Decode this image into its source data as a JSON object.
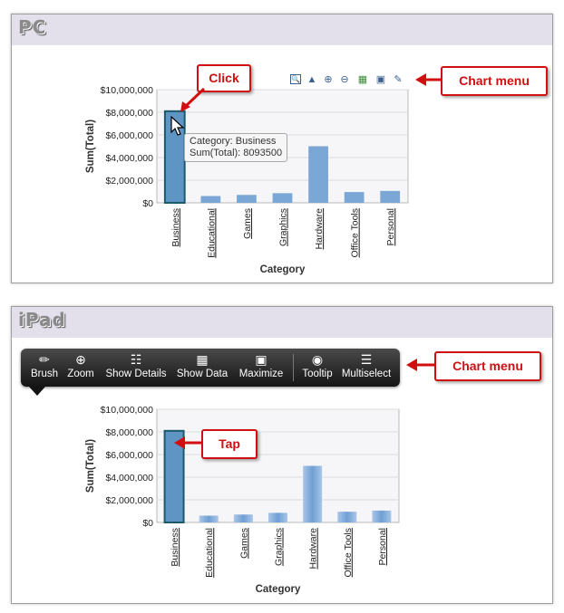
{
  "pc": {
    "title": "PC",
    "callout_click": "Click",
    "callout_menu": "Chart menu",
    "tooltip_line1": "Category: Business",
    "tooltip_line2": "Sum(Total): 8093500",
    "menu_icons": [
      "details-icon",
      "tooltip-icon",
      "zoom-in-icon",
      "zoom-out-icon",
      "show-data-icon",
      "maximize-icon",
      "edit-icon"
    ]
  },
  "ipad": {
    "title": "iPad",
    "callout_tap": "Tap",
    "callout_menu": "Chart menu",
    "toolbar": [
      {
        "label": "Brush",
        "icon": "brush-icon"
      },
      {
        "label": "Zoom",
        "icon": "zoom-icon"
      },
      {
        "label": "Show Details",
        "icon": "details-icon"
      },
      {
        "label": "Show Data",
        "icon": "grid-icon"
      },
      {
        "label": "Maximize",
        "icon": "maximize-icon"
      },
      {
        "label": "Tooltip",
        "icon": "speech-bubble-icon"
      },
      {
        "label": "Multiselect",
        "icon": "checklist-icon"
      }
    ]
  },
  "colors": {
    "bar": "#7ba7d6",
    "selected_bar": "#5f95c4",
    "selected_border": "#1c5a6b",
    "callout": "#d01010"
  },
  "chart_data": [
    {
      "type": "bar",
      "categories": [
        "Business",
        "Educational",
        "Games",
        "Graphics",
        "Hardware",
        "Office Tools",
        "Personal"
      ],
      "values": [
        8093500,
        600000,
        700000,
        850000,
        5000000,
        950000,
        1050000
      ],
      "xlabel": "Category",
      "ylabel": "Sum(Total)",
      "ylim": [
        0,
        10000000
      ],
      "yticks": [
        "$0",
        "$2,000,000",
        "$4,000,000",
        "$6,000,000",
        "$8,000,000",
        "$10,000,000"
      ],
      "selected": "Business"
    },
    {
      "type": "bar",
      "categories": [
        "Business",
        "Educational",
        "Games",
        "Graphics",
        "Hardware",
        "Office Tools",
        "Personal"
      ],
      "values": [
        8093500,
        600000,
        700000,
        850000,
        5000000,
        950000,
        1050000
      ],
      "xlabel": "Category",
      "ylabel": "Sum(Total)",
      "ylim": [
        0,
        10000000
      ],
      "yticks": [
        "$0",
        "$2,000,000",
        "$4,000,000",
        "$6,000,000",
        "$8,000,000",
        "$10,000,000"
      ],
      "selected": "Business"
    }
  ]
}
